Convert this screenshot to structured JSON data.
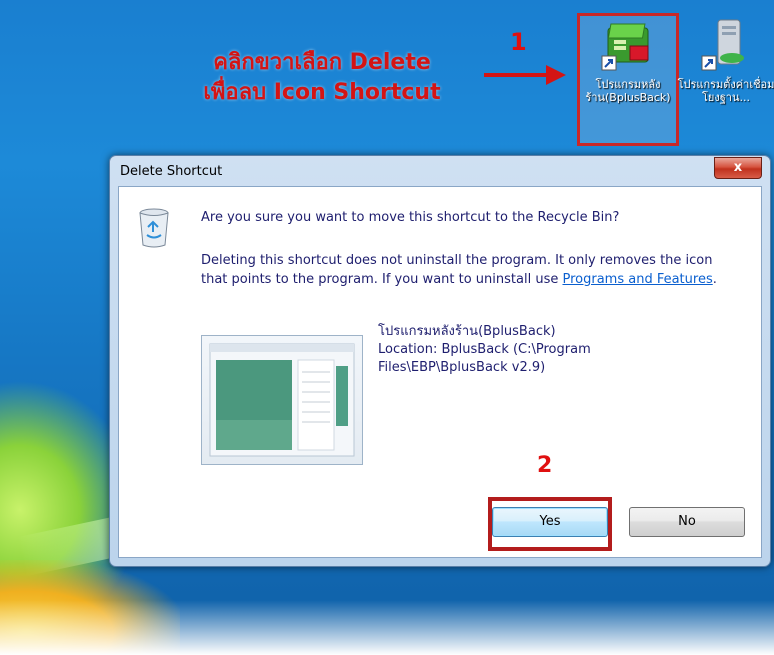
{
  "instruction": {
    "line1": "คลิกขวาเลือก Delete",
    "line2": "เพื่อลบ Icon Shortcut",
    "step1": "1",
    "step2": "2"
  },
  "desktop_icons": [
    {
      "label": "โปรแกรมหลังร้าน(BplusBack)",
      "icon": "bplusback-program-icon"
    },
    {
      "label": "โปรแกรมตั้งค่าเชื่อมโยงฐาน...",
      "icon": "database-program-icon"
    }
  ],
  "dialog": {
    "title": "Delete Shortcut",
    "close_label": "x",
    "question": "Are you sure you want to move this shortcut to the Recycle Bin?",
    "desc_text": "Deleting this shortcut does not uninstall the program. It only removes the icon that points to the program. If you want to uninstall use ",
    "link_text": "Programs and Features",
    "desc_end": ".",
    "shortcut_name": "โปรแกรมหลังร้าน(BplusBack)",
    "location_line1": "Location: BplusBack (C:\\Program",
    "location_line2": "Files\\EBP\\BplusBack v2.9)",
    "yes_label": "Yes",
    "no_label": "No"
  },
  "colors": {
    "annotation_red": "#d41414",
    "link_blue": "#0a5fcf"
  }
}
